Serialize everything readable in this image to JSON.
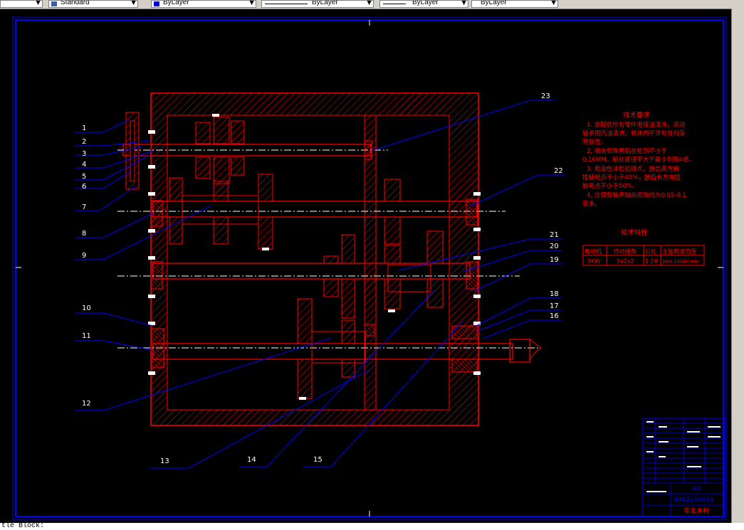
{
  "toolbar": {
    "text_style": "Standard",
    "layer_color": "ByLayer",
    "linetype": "ByLayer",
    "lineweight": "ByLayer",
    "plot_style": "ByLayer"
  },
  "colors": {
    "part": "#ff0000",
    "leader": "#0000ff",
    "frame": "#0000ff",
    "label": "#ffffff",
    "notes": "#ff0000",
    "background": "#000000"
  },
  "drawing": {
    "part_numbers": [
      "1",
      "2",
      "3",
      "4",
      "5",
      "6",
      "7",
      "8",
      "9",
      "10",
      "11",
      "12",
      "13",
      "14",
      "15",
      "16",
      "17",
      "18",
      "19",
      "20",
      "21",
      "22",
      "23"
    ],
    "tech_requirements": {
      "title": "技术要求",
      "lines": [
        "1. 装配前所有零件用煤油清洗，滚动",
        "轴承用汽油清洗，机体内不许有任何杂",
        "物存在。",
        "2. 啮合侧隙用铅丝检测不小于",
        "0.16MM，铅丝直径不大于最小侧隙4倍。",
        "3. 用涂色法检验斑点，按齿高方向",
        "接触斑点不小于40%，按齿长方向接",
        "触斑点不小于50%。",
        "4. 应调整轴承轴向间隙均为0.05-0.1",
        "毫米。"
      ]
    },
    "tech_specs": {
      "title": "技术特性",
      "headers": [
        "电动机",
        "传动级数",
        "公比",
        "主轴转速范围"
      ],
      "row": [
        "3KW",
        "3x2x2",
        "1.26",
        "160-2000r/min"
      ]
    },
    "title_block": {
      "code": "0402L40409",
      "school": "华北水利",
      "sheet": "A0"
    }
  },
  "command_line": "tle Block: "
}
